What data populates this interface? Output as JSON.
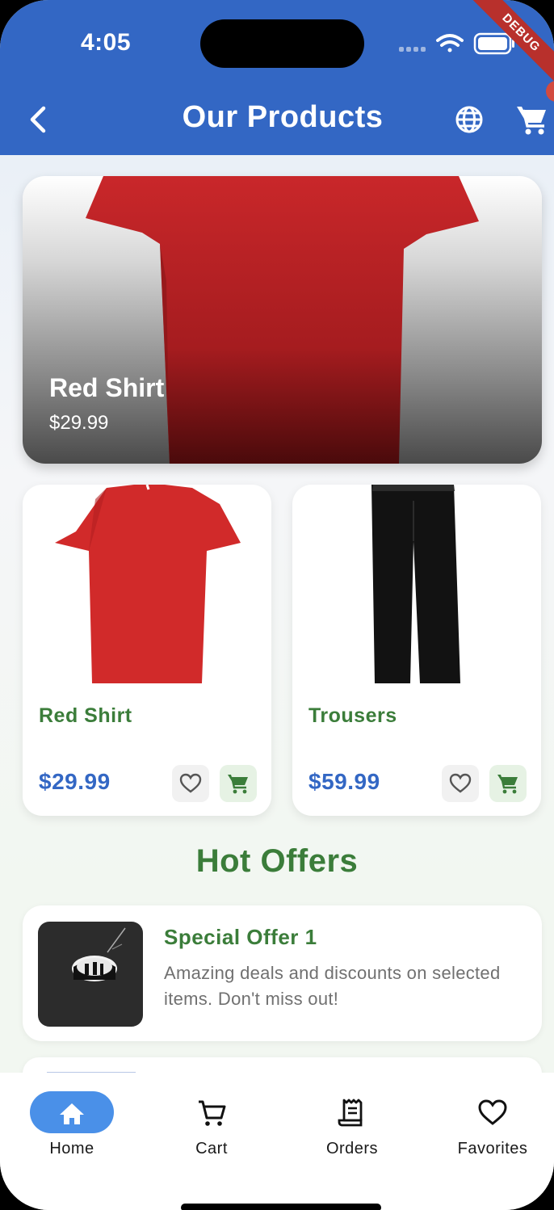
{
  "status_bar": {
    "time": "4:05",
    "debug_label": "DEBUG"
  },
  "app_bar": {
    "title": "Our Products",
    "back_icon": "chevron-left-icon",
    "language_icon": "globe-icon",
    "cart_icon": "shopping-cart-icon"
  },
  "featured": {
    "name": "Red Shirt",
    "price": "$29.99"
  },
  "products": [
    {
      "name": "Red Shirt",
      "price": "$29.99",
      "favorite_icon": "heart-outline-icon",
      "cart_icon": "add-to-cart-icon"
    },
    {
      "name": "Trousers",
      "price": "$59.99",
      "favorite_icon": "heart-outline-icon",
      "cart_icon": "add-to-cart-icon"
    }
  ],
  "hot_offers": {
    "title": "Hot Offers",
    "items": [
      {
        "title": "Special Offer 1",
        "description": "Amazing deals and discounts on selected items. Don't miss out!"
      }
    ]
  },
  "bottom_nav": {
    "items": [
      {
        "label": "Home",
        "icon": "home-icon",
        "active": true
      },
      {
        "label": "Cart",
        "icon": "cart-icon",
        "active": false
      },
      {
        "label": "Orders",
        "icon": "receipt-icon",
        "active": false
      },
      {
        "label": "Favorites",
        "icon": "heart-outline-icon",
        "active": false
      }
    ]
  },
  "colors": {
    "primary": "#3367c4",
    "accent_green": "#3b7d3a",
    "nav_active": "#4a90e8",
    "background": "#f2f6f1"
  }
}
